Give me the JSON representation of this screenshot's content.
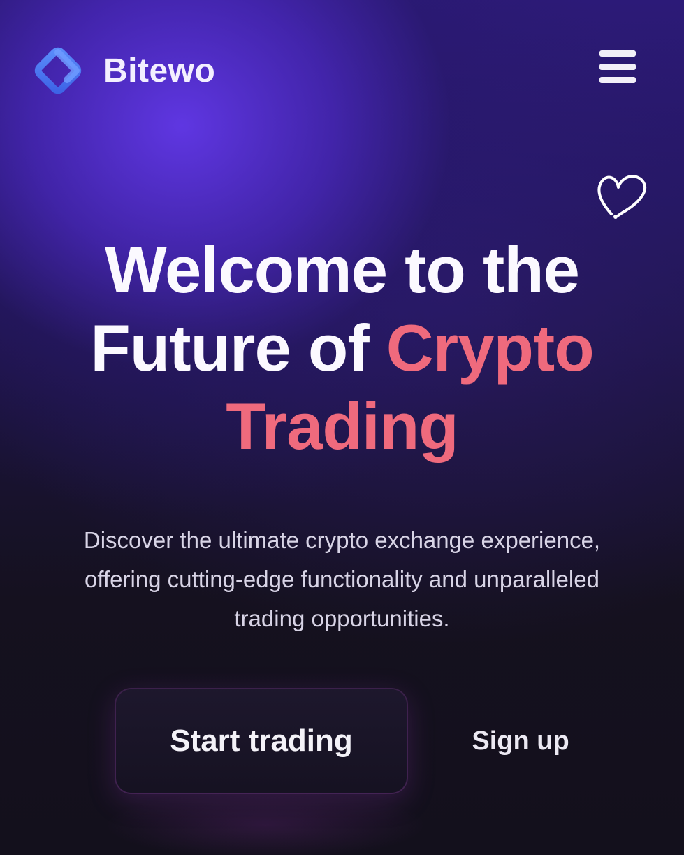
{
  "header": {
    "brand_name": "Bitewo",
    "logo_icon": "diamond-logo-icon",
    "menu_icon": "hamburger-menu-icon"
  },
  "decoration": {
    "heart_icon": "heart-doodle-icon"
  },
  "hero": {
    "headline_line1": "Welcome to the",
    "headline_line2_white": "Future of ",
    "headline_line2_accent": "Crypto",
    "headline_line3_accent": "Trading",
    "subtitle": "Discover the ultimate crypto exchange experience, offering cutting-edge functionality and unparalleled trading opportunities."
  },
  "actions": {
    "primary_label": "Start trading",
    "secondary_label": "Sign up"
  },
  "colors": {
    "accent": "#ef6a7d",
    "logo_blue": "#4a7cf7",
    "background_top": "#2c1a78",
    "background_bottom": "#13101c"
  }
}
